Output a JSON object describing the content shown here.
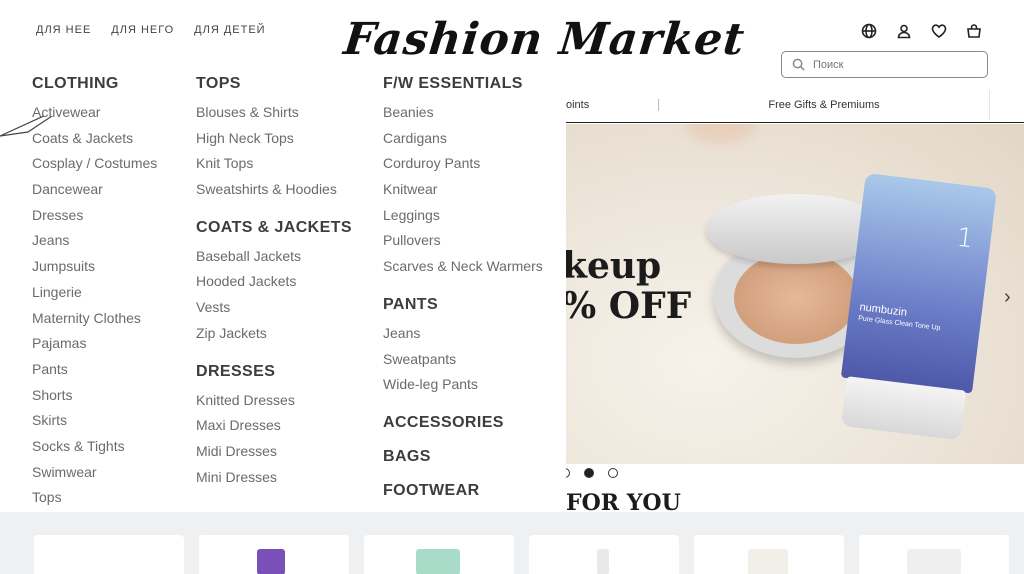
{
  "topnav": [
    "ДЛЯ НЕЕ",
    "ДЛЯ НЕГО",
    "ДЛЯ ДЕТЕЙ"
  ],
  "logo": "Fashion Market",
  "icons": [
    "globe-icon",
    "user-icon",
    "heart-icon",
    "bag-icon"
  ],
  "search": {
    "placeholder": "Поиск"
  },
  "subbar": {
    "item1": "oints",
    "item2": "Free Gifts & Premiums"
  },
  "hero": {
    "line1": "keup",
    "line2": "% OFF",
    "product_label": "numbuzin",
    "product_sub": "Pure Glass Clean Tone Up",
    "product_num": "1"
  },
  "section_title": "FOR YOU",
  "menu": {
    "col1": {
      "title": "CLOTHING",
      "items": [
        "Activewear",
        "Coats & Jackets",
        "Cosplay / Costumes",
        "Dancewear",
        "Dresses",
        "Jeans",
        "Jumpsuits",
        "Lingerie",
        "Maternity Clothes",
        "Pajamas",
        "Pants",
        "Shorts",
        "Skirts",
        "Socks & Tights",
        "Swimwear",
        "Tops"
      ]
    },
    "col2": [
      {
        "title": "TOPS",
        "items": [
          "Blouses & Shirts",
          "High Neck Tops",
          "Knit Tops",
          "Sweatshirts & Hoodies"
        ]
      },
      {
        "title": "COATS & JACKETS",
        "items": [
          "Baseball Jackets",
          "Hooded Jackets",
          "Vests",
          "Zip Jackets"
        ]
      },
      {
        "title": "DRESSES",
        "items": [
          "Knitted Dresses",
          "Maxi Dresses",
          "Midi Dresses",
          "Mini Dresses"
        ]
      }
    ],
    "col3": [
      {
        "title": "F/W ESSENTIALS",
        "items": [
          "Beanies",
          "Cardigans",
          "Corduroy Pants",
          "Knitwear",
          "Leggings",
          "Pullovers",
          "Scarves & Neck Warmers"
        ]
      },
      {
        "title": "PANTS",
        "items": [
          "Jeans",
          "Sweatpants",
          "Wide-leg Pants"
        ]
      },
      {
        "title": "ACCESSORIES",
        "items": []
      },
      {
        "title": "BAGS",
        "items": []
      },
      {
        "title": "FOOTWEAR",
        "items": []
      }
    ]
  },
  "colors": {
    "accent": "#1b1b1b",
    "strip_bg": "#eef0f2",
    "menu_text": "#6b6b6b"
  }
}
